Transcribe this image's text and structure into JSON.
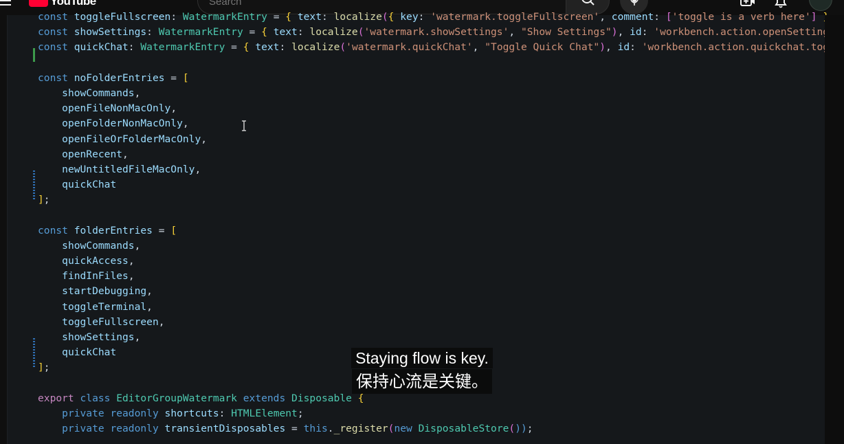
{
  "youtube": {
    "logo_text": "YouTube",
    "search_placeholder": "Search"
  },
  "editor": {
    "lines": [
      {
        "tokens": [
          [
            "kw2",
            "const "
          ],
          [
            "var",
            "toggleFullscreen"
          ],
          [
            "pn",
            ": "
          ],
          [
            "typ",
            "WatermarkEntry"
          ],
          [
            "pn",
            " = "
          ],
          [
            "br",
            "{ "
          ],
          [
            "var",
            "text"
          ],
          [
            "pn",
            ": "
          ],
          [
            "fn",
            "localize"
          ],
          [
            "br2",
            "("
          ],
          [
            "br",
            "{ "
          ],
          [
            "var",
            "key"
          ],
          [
            "pn",
            ": "
          ],
          [
            "str",
            "'watermark.toggleFullscreen'"
          ],
          [
            "pn",
            ", "
          ],
          [
            "var",
            "comment"
          ],
          [
            "pn",
            ": "
          ],
          [
            "br2",
            "["
          ],
          [
            "str",
            "'toggle is a verb here'"
          ],
          [
            "br2",
            "]"
          ],
          [
            "br",
            " }"
          ],
          [
            "pn",
            ","
          ]
        ]
      },
      {
        "tokens": [
          [
            "kw2",
            "const "
          ],
          [
            "var",
            "showSettings"
          ],
          [
            "pn",
            ": "
          ],
          [
            "typ",
            "WatermarkEntry"
          ],
          [
            "pn",
            " = "
          ],
          [
            "br",
            "{ "
          ],
          [
            "var",
            "text"
          ],
          [
            "pn",
            ": "
          ],
          [
            "fn",
            "localize"
          ],
          [
            "br2",
            "("
          ],
          [
            "str",
            "'watermark.showSettings'"
          ],
          [
            "pn",
            ", "
          ],
          [
            "str",
            "\"Show Settings\""
          ],
          [
            "br2",
            ")"
          ],
          [
            "pn",
            ", "
          ],
          [
            "var",
            "id"
          ],
          [
            "pn",
            ": "
          ],
          [
            "str",
            "'workbench.action.openSettings"
          ]
        ]
      },
      {
        "tokens": [
          [
            "kw2",
            "const "
          ],
          [
            "var",
            "quickChat"
          ],
          [
            "pn",
            ": "
          ],
          [
            "typ",
            "WatermarkEntry"
          ],
          [
            "pn",
            " = "
          ],
          [
            "br",
            "{ "
          ],
          [
            "var",
            "text"
          ],
          [
            "pn",
            ": "
          ],
          [
            "fn",
            "localize"
          ],
          [
            "br2",
            "("
          ],
          [
            "str",
            "'watermark.quickChat'"
          ],
          [
            "pn",
            ", "
          ],
          [
            "str",
            "\"Toggle Quick Chat\""
          ],
          [
            "br2",
            ")"
          ],
          [
            "pn",
            ", "
          ],
          [
            "var",
            "id"
          ],
          [
            "pn",
            ": "
          ],
          [
            "str",
            "'workbench.action.quickchat.togg"
          ]
        ]
      },
      {
        "tokens": []
      },
      {
        "tokens": [
          [
            "kw2",
            "const "
          ],
          [
            "var",
            "noFolderEntries"
          ],
          [
            "pn",
            " = "
          ],
          [
            "br",
            "["
          ]
        ]
      },
      {
        "tokens": [
          [
            "pn",
            "    "
          ],
          [
            "var",
            "showCommands"
          ],
          [
            "pn",
            ","
          ]
        ]
      },
      {
        "tokens": [
          [
            "pn",
            "    "
          ],
          [
            "var",
            "openFileNonMacOnly"
          ],
          [
            "pn",
            ","
          ]
        ]
      },
      {
        "tokens": [
          [
            "pn",
            "    "
          ],
          [
            "var",
            "openFolderNonMacOnly"
          ],
          [
            "pn",
            ","
          ]
        ]
      },
      {
        "tokens": [
          [
            "pn",
            "    "
          ],
          [
            "var",
            "openFileOrFolderMacOnly"
          ],
          [
            "pn",
            ","
          ]
        ]
      },
      {
        "tokens": [
          [
            "pn",
            "    "
          ],
          [
            "var",
            "openRecent"
          ],
          [
            "pn",
            ","
          ]
        ]
      },
      {
        "tokens": [
          [
            "pn",
            "    "
          ],
          [
            "var",
            "newUntitledFileMacOnly"
          ],
          [
            "pn",
            ","
          ]
        ]
      },
      {
        "tokens": [
          [
            "pn",
            "    "
          ],
          [
            "var",
            "quickChat"
          ]
        ]
      },
      {
        "tokens": [
          [
            "br",
            "]"
          ],
          [
            "pn",
            ";"
          ]
        ]
      },
      {
        "tokens": []
      },
      {
        "tokens": [
          [
            "kw2",
            "const "
          ],
          [
            "var",
            "folderEntries"
          ],
          [
            "pn",
            " = "
          ],
          [
            "br",
            "["
          ]
        ]
      },
      {
        "tokens": [
          [
            "pn",
            "    "
          ],
          [
            "var",
            "showCommands"
          ],
          [
            "pn",
            ","
          ]
        ]
      },
      {
        "tokens": [
          [
            "pn",
            "    "
          ],
          [
            "var",
            "quickAccess"
          ],
          [
            "pn",
            ","
          ]
        ]
      },
      {
        "tokens": [
          [
            "pn",
            "    "
          ],
          [
            "var",
            "findInFiles"
          ],
          [
            "pn",
            ","
          ]
        ]
      },
      {
        "tokens": [
          [
            "pn",
            "    "
          ],
          [
            "var",
            "startDebugging"
          ],
          [
            "pn",
            ","
          ]
        ]
      },
      {
        "tokens": [
          [
            "pn",
            "    "
          ],
          [
            "var",
            "toggleTerminal"
          ],
          [
            "pn",
            ","
          ]
        ]
      },
      {
        "tokens": [
          [
            "pn",
            "    "
          ],
          [
            "var",
            "toggleFullscreen"
          ],
          [
            "pn",
            ","
          ]
        ]
      },
      {
        "tokens": [
          [
            "pn",
            "    "
          ],
          [
            "var",
            "showSettings"
          ],
          [
            "pn",
            ","
          ]
        ]
      },
      {
        "tokens": [
          [
            "pn",
            "    "
          ],
          [
            "var",
            "quickChat"
          ]
        ]
      },
      {
        "tokens": [
          [
            "br",
            "]"
          ],
          [
            "pn",
            ";"
          ]
        ]
      },
      {
        "tokens": []
      },
      {
        "tokens": [
          [
            "kw",
            "export "
          ],
          [
            "kw2",
            "class "
          ],
          [
            "typ",
            "EditorGroupWatermark "
          ],
          [
            "kw2",
            "extends "
          ],
          [
            "typ",
            "Disposable "
          ],
          [
            "br",
            "{"
          ]
        ]
      },
      {
        "tokens": [
          [
            "pn",
            "    "
          ],
          [
            "kw2",
            "private "
          ],
          [
            "kw2",
            "readonly "
          ],
          [
            "var",
            "shortcuts"
          ],
          [
            "pn",
            ": "
          ],
          [
            "typ",
            "HTMLElement"
          ],
          [
            "pn",
            ";"
          ]
        ]
      },
      {
        "tokens": [
          [
            "pn",
            "    "
          ],
          [
            "kw2",
            "private "
          ],
          [
            "kw2",
            "readonly "
          ],
          [
            "var",
            "transientDisposables"
          ],
          [
            "pn",
            " = "
          ],
          [
            "kw2",
            "this"
          ],
          [
            "pn",
            "."
          ],
          [
            "fn",
            "_register"
          ],
          [
            "br2",
            "("
          ],
          [
            "kw2",
            "new "
          ],
          [
            "typ",
            "DisposableStore"
          ],
          [
            "br2",
            "("
          ],
          [
            "kw2",
            "))"
          ],
          [
            "pn",
            ";"
          ]
        ]
      }
    ]
  },
  "subtitles": {
    "english": "Staying flow is key.",
    "chinese": "保持心流是关键。"
  }
}
